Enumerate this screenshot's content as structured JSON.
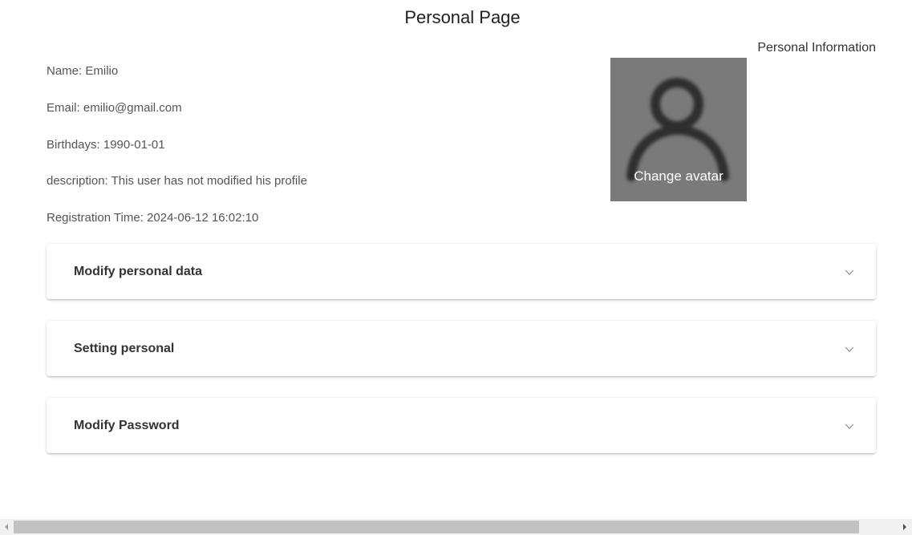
{
  "header": {
    "title": "Personal Page",
    "section_label": "Personal Information"
  },
  "profile": {
    "fields": [
      {
        "label": "Name:",
        "value": "Emilio"
      },
      {
        "label": "Email:",
        "value": "emilio@gmail.com"
      },
      {
        "label": "Birthdays:",
        "value": "1990-01-01"
      },
      {
        "label": "description:",
        "value": "This user has not modified his profile"
      },
      {
        "label": "Registration Time:",
        "value": "2024-06-12 16:02:10"
      }
    ]
  },
  "avatar": {
    "icon": "user-silhouette-icon",
    "caption": "Change avatar"
  },
  "panels": [
    {
      "title": "Modify personal data",
      "icon": "chevron-down-icon",
      "expanded": false
    },
    {
      "title": "Setting personal",
      "icon": "chevron-down-icon",
      "expanded": false
    },
    {
      "title": "Modify Password",
      "icon": "chevron-down-icon",
      "expanded": false
    }
  ],
  "colors": {
    "avatar_bg": "#7a7a7a",
    "text": "#333333",
    "muted_text": "#555555",
    "scroll_track": "#f1f1f1",
    "scroll_thumb": "#c1c1c1"
  }
}
